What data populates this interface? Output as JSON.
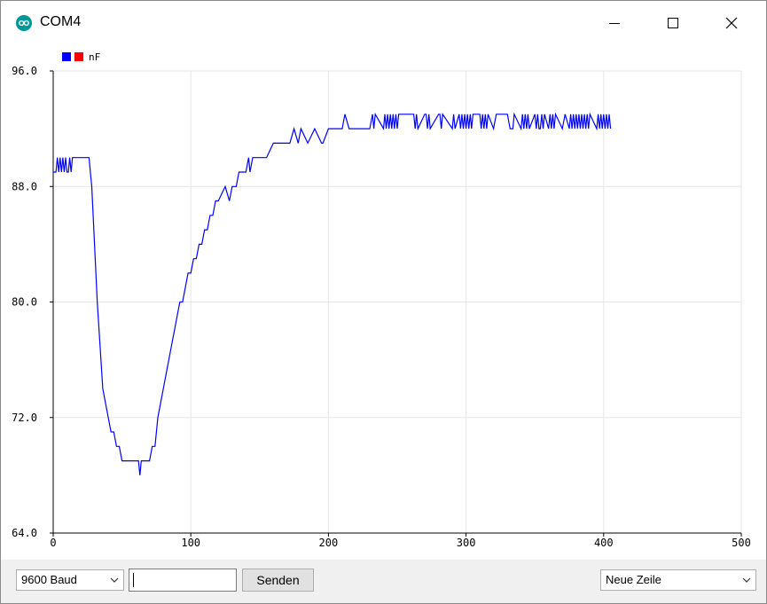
{
  "window": {
    "title": "COM4"
  },
  "chart_data": {
    "type": "line",
    "title": "",
    "xlabel": "",
    "ylabel": "",
    "xlim": [
      0,
      500
    ],
    "ylim": [
      64.0,
      96.0
    ],
    "x_ticks": [
      "0",
      "100",
      "200",
      "300",
      "400",
      "500"
    ],
    "y_ticks": [
      "64.0",
      "72.0",
      "80.0",
      "88.0",
      "96.0"
    ],
    "grid": true,
    "legend": {
      "position": "top-left",
      "label": "nF",
      "swatch_colors": [
        "#0000ff",
        "#ff0000"
      ]
    },
    "series": [
      {
        "color": "#0000ff",
        "x": [
          0,
          2,
          3,
          4,
          5,
          6,
          7,
          8,
          9,
          10,
          11,
          12,
          13,
          14,
          15,
          25,
          26,
          27,
          28,
          30,
          32,
          34,
          36,
          38,
          40,
          42,
          44,
          46,
          48,
          50,
          55,
          60,
          62,
          63,
          64,
          65,
          70,
          72,
          74,
          76,
          78,
          80,
          82,
          84,
          86,
          88,
          90,
          92,
          94,
          96,
          98,
          100,
          102,
          104,
          106,
          108,
          110,
          112,
          114,
          116,
          118,
          120,
          125,
          128,
          130,
          133,
          135,
          138,
          140,
          142,
          143,
          145,
          148,
          150,
          152,
          155,
          160,
          165,
          168,
          170,
          172,
          175,
          178,
          180,
          185,
          190,
          195,
          196,
          200,
          205,
          206,
          207,
          208,
          210,
          212,
          215,
          220,
          225,
          230,
          232,
          233,
          234,
          240,
          241,
          242,
          243,
          244,
          245,
          246,
          247,
          248,
          249,
          250,
          251,
          260,
          262,
          263,
          264,
          265,
          270,
          271,
          272,
          273,
          274,
          280,
          281,
          282,
          283,
          290,
          291,
          292,
          295,
          296,
          297,
          298,
          299,
          300,
          301,
          302,
          303,
          304,
          305,
          310,
          311,
          312,
          313,
          314,
          315,
          316,
          320,
          322,
          330,
          332,
          333,
          334,
          335,
          340,
          341,
          342,
          343,
          344,
          345,
          346,
          350,
          351,
          352,
          353,
          354,
          355,
          356,
          357,
          360,
          361,
          362,
          363,
          364,
          365,
          370,
          372,
          375,
          376,
          377,
          378,
          379,
          380,
          381,
          382,
          383,
          384,
          385,
          386,
          387,
          388,
          389,
          390,
          395,
          396,
          397,
          398,
          399,
          400,
          401,
          402,
          403,
          404,
          405
        ],
        "values": [
          89,
          89,
          90,
          89,
          90,
          89,
          90,
          89,
          90,
          89,
          89,
          90,
          89,
          90,
          90,
          90,
          90,
          89,
          88,
          84,
          80,
          77,
          74,
          73,
          72,
          71,
          71,
          70,
          70,
          69,
          69,
          69,
          69,
          68,
          69,
          69,
          69,
          70,
          70,
          72,
          73,
          74,
          75,
          76,
          77,
          78,
          79,
          80,
          80,
          81,
          82,
          82,
          83,
          83,
          84,
          84,
          85,
          85,
          86,
          86,
          87,
          87,
          88,
          87,
          88,
          88,
          89,
          89,
          89,
          90,
          89,
          90,
          90,
          90,
          90,
          90,
          91,
          91,
          91,
          91,
          91,
          92,
          91,
          92,
          91,
          92,
          91,
          91,
          92,
          92,
          92,
          92,
          92,
          92,
          93,
          92,
          92,
          92,
          92,
          93,
          92,
          93,
          92,
          93,
          92,
          93,
          92,
          93,
          92,
          93,
          92,
          93,
          92,
          93,
          93,
          93,
          92,
          93,
          92,
          93,
          93,
          92,
          93,
          92,
          93,
          93,
          92,
          93,
          92,
          93,
          92,
          93,
          92,
          93,
          92,
          93,
          92,
          93,
          92,
          93,
          92,
          93,
          93,
          92,
          93,
          92,
          93,
          92,
          93,
          92,
          93,
          93,
          92,
          92,
          92,
          93,
          92,
          93,
          92,
          93,
          92,
          93,
          92,
          93,
          92,
          93,
          92,
          92,
          93,
          92,
          93,
          92,
          93,
          92,
          93,
          92,
          93,
          92,
          93,
          92,
          93,
          92,
          93,
          92,
          93,
          92,
          93,
          92,
          93,
          92,
          93,
          92,
          93,
          92,
          93,
          92,
          93,
          92,
          93,
          92,
          93,
          92,
          93,
          92,
          93,
          92
        ]
      }
    ]
  },
  "controls": {
    "baud_value": "9600 Baud",
    "send_input_value": "",
    "send_label": "Senden",
    "line_ending_value": "Neue Zeile"
  },
  "icons": {
    "app": "arduino-logo-icon",
    "minimize": "minimize-icon",
    "maximize": "maximize-icon",
    "close": "close-icon",
    "dropdown": "chevron-down-icon"
  }
}
